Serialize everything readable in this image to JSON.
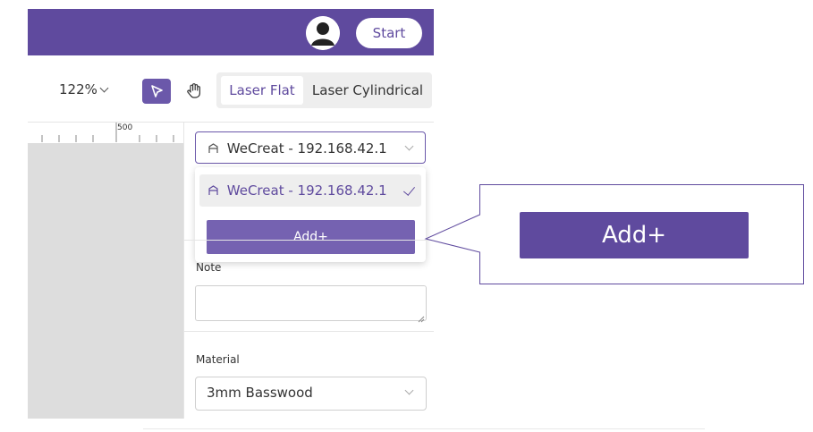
{
  "header": {
    "start_label": "Start",
    "avatar_icon": "user-avatar-icon",
    "bg_color": "#5f4a9e"
  },
  "toolbar": {
    "zoom": "122%",
    "select_icon": "cursor-arrow-icon",
    "hand_icon": "hand-pan-icon",
    "modes": [
      "Laser Flat",
      "Laser Cylindrical"
    ],
    "active_mode": "Laser Flat"
  },
  "ruler": {
    "label": "500"
  },
  "device": {
    "selected": "WeCreat - 192.168.42.1",
    "icon": "device-icon",
    "options": [
      {
        "label": "WeCreat - 192.168.42.1",
        "selected": true
      }
    ],
    "add_label": "Add+"
  },
  "note": {
    "label": "Note",
    "value": ""
  },
  "material": {
    "label": "Material",
    "value": "3mm Basswood"
  },
  "callout": {
    "label": "Add+"
  },
  "colors": {
    "accent": "#5f4a9e",
    "accent_light": "#7562b1",
    "canvas": "#dddddd"
  }
}
